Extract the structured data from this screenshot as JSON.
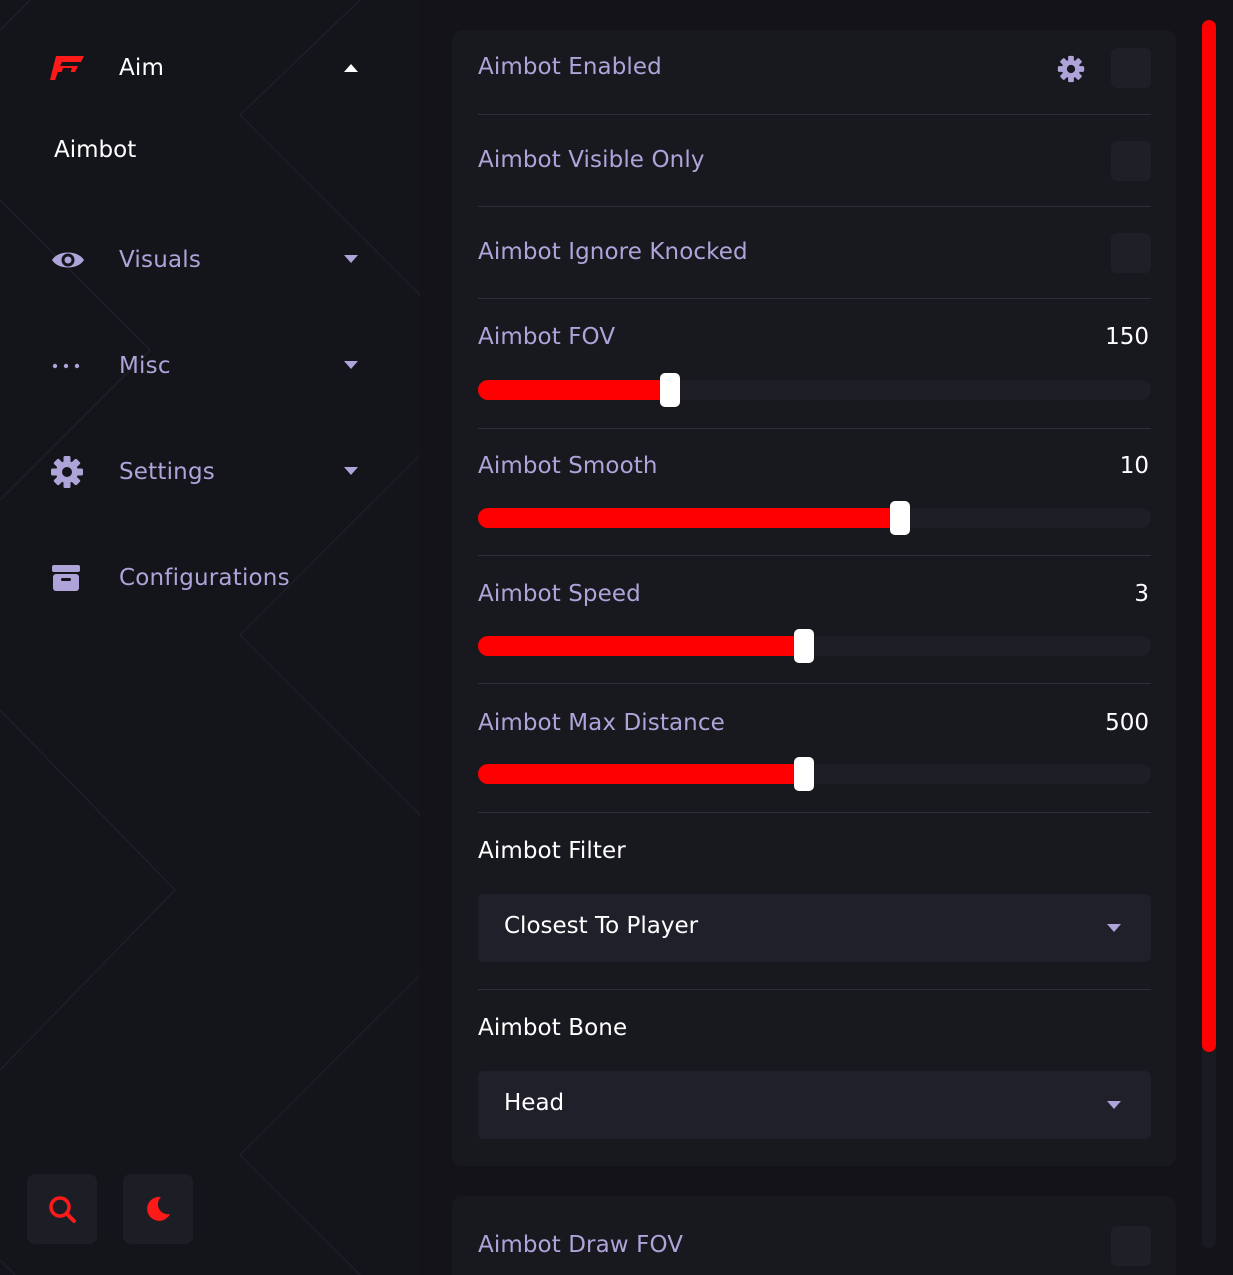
{
  "theme": {
    "accent": "#ff0000",
    "label_color": "#aea4d9",
    "background": "#131319",
    "panel": "#18181f"
  },
  "sidebar": {
    "items": [
      {
        "label": "Aim",
        "icon": "brand-logo-icon",
        "expanded": true,
        "active": true
      },
      {
        "label": "Visuals",
        "icon": "eye-icon",
        "expanded": false
      },
      {
        "label": "Misc",
        "icon": "ellipsis-icon",
        "expanded": false
      },
      {
        "label": "Settings",
        "icon": "gear-icon",
        "expanded": false
      },
      {
        "label": "Configurations",
        "icon": "archive-box-icon"
      }
    ],
    "sub_items": [
      {
        "label": "Aimbot"
      }
    ],
    "bottom_buttons": [
      {
        "icon": "search-icon"
      },
      {
        "icon": "moon-icon"
      }
    ]
  },
  "settings": {
    "toggles": [
      {
        "label": "Aimbot Enabled",
        "has_gear": true,
        "checked": false
      },
      {
        "label": "Aimbot Visible Only",
        "checked": false
      },
      {
        "label": "Aimbot Ignore Knocked",
        "checked": false
      }
    ],
    "sliders": [
      {
        "label": "Aimbot FOV",
        "value": "150",
        "fill_fraction": 0.285
      },
      {
        "label": "Aimbot Smooth",
        "value": "10",
        "fill_fraction": 0.627
      },
      {
        "label": "Aimbot Speed",
        "value": "3",
        "fill_fraction": 0.485
      },
      {
        "label": "Aimbot Max Distance",
        "value": "500",
        "fill_fraction": 0.485
      }
    ],
    "selects": [
      {
        "label": "Aimbot Filter",
        "value": "Closest To Player"
      },
      {
        "label": "Aimbot Bone",
        "value": "Head"
      }
    ],
    "draw_fov": {
      "label": "Aimbot Draw FOV",
      "checked": false
    }
  },
  "scrollbar": {
    "position_fraction": 0.0,
    "visible_fraction": 0.84
  }
}
